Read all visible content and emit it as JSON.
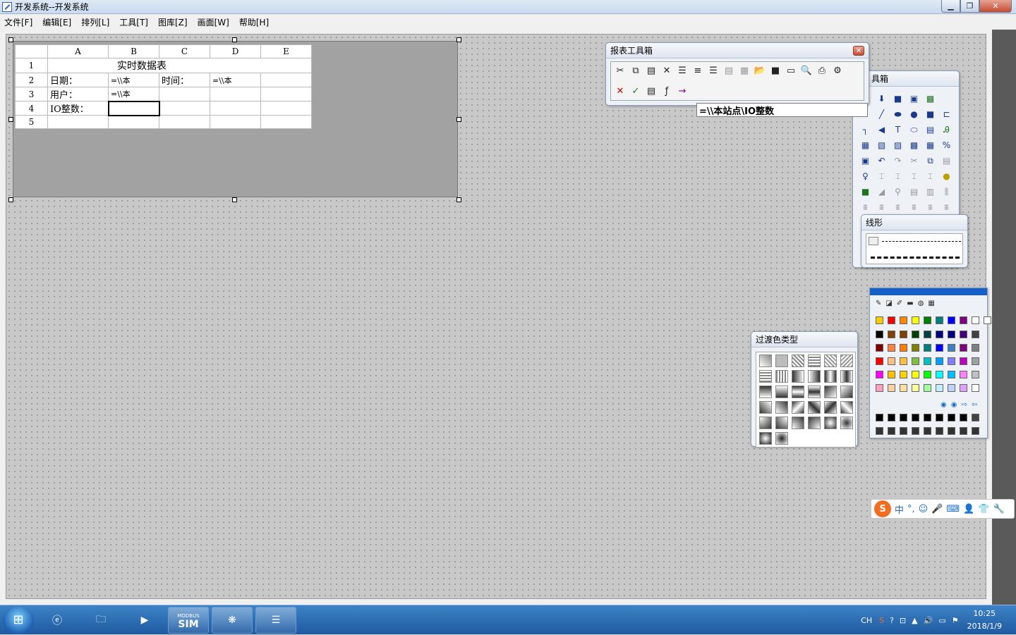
{
  "window": {
    "title": "开发系统--开发系统",
    "min": "▁",
    "max": "❐",
    "close": "✕"
  },
  "menu": [
    "文件[F]",
    "编辑[E]",
    "排列[L]",
    "工具[T]",
    "图库[Z]",
    "画面[W]",
    "帮助[H]"
  ],
  "report": {
    "columns": [
      "A",
      "B",
      "C",
      "D",
      "E"
    ],
    "rows": [
      "1",
      "2",
      "3",
      "4",
      "5"
    ],
    "title": "实时数据表",
    "date_label": "日期：",
    "date_value": "=\\\\本",
    "time_label": "时间：",
    "time_value": "=\\\\本",
    "user_label": "用户：",
    "user_value": "=\\\\本",
    "io_label": "IO整数："
  },
  "report_toolbox": {
    "title": "报表工具箱",
    "formula": "=\\\\本站点\\IO整数",
    "close": "✕"
  },
  "toolbox": {
    "title_partial": "具箱"
  },
  "line_panel": {
    "title": "线形"
  },
  "gradient_panel": {
    "title": "过渡色类型"
  },
  "colors": {
    "accent": "#1460c8",
    "palette_row0": [
      "#ffcc00",
      "#ff0000",
      "#ff8800",
      "#ffff00",
      "#008000",
      "#008080",
      "#0000ff",
      "#800080",
      "#ffffff",
      "#ffffff"
    ],
    "palette": [
      [
        "#000000",
        "#804000",
        "#804000",
        "#004000",
        "#004040",
        "#000080",
        "#000080",
        "#400080",
        "#404040"
      ],
      [
        "#800000",
        "#ff8040",
        "#ff8000",
        "#808000",
        "#008080",
        "#0000ff",
        "#4080c0",
        "#800080",
        "#808080"
      ],
      [
        "#ff0000",
        "#ffc080",
        "#ffc040",
        "#80c040",
        "#00c0c0",
        "#00a0ff",
        "#8080ff",
        "#c000c0",
        "#a0a0a0"
      ],
      [
        "#ff00ff",
        "#ffc000",
        "#ffd000",
        "#ffff00",
        "#00ff00",
        "#00ffff",
        "#00c0ff",
        "#ff80ff",
        "#c0c0c0"
      ],
      [
        "#ffa0c0",
        "#ffd0a0",
        "#ffe0a0",
        "#ffffa0",
        "#a0ffa0",
        "#c0f0ff",
        "#c0d0ff",
        "#e0a0ff",
        "#ffffff"
      ]
    ]
  },
  "ime": {
    "logo": "S",
    "mode": "中",
    "punct": "°,"
  },
  "taskbar": {
    "sim_top": "MODBUS",
    "sim": "SIM"
  },
  "tray": {
    "lang": "CH",
    "time": "10:25",
    "date": "2018/1/9"
  }
}
